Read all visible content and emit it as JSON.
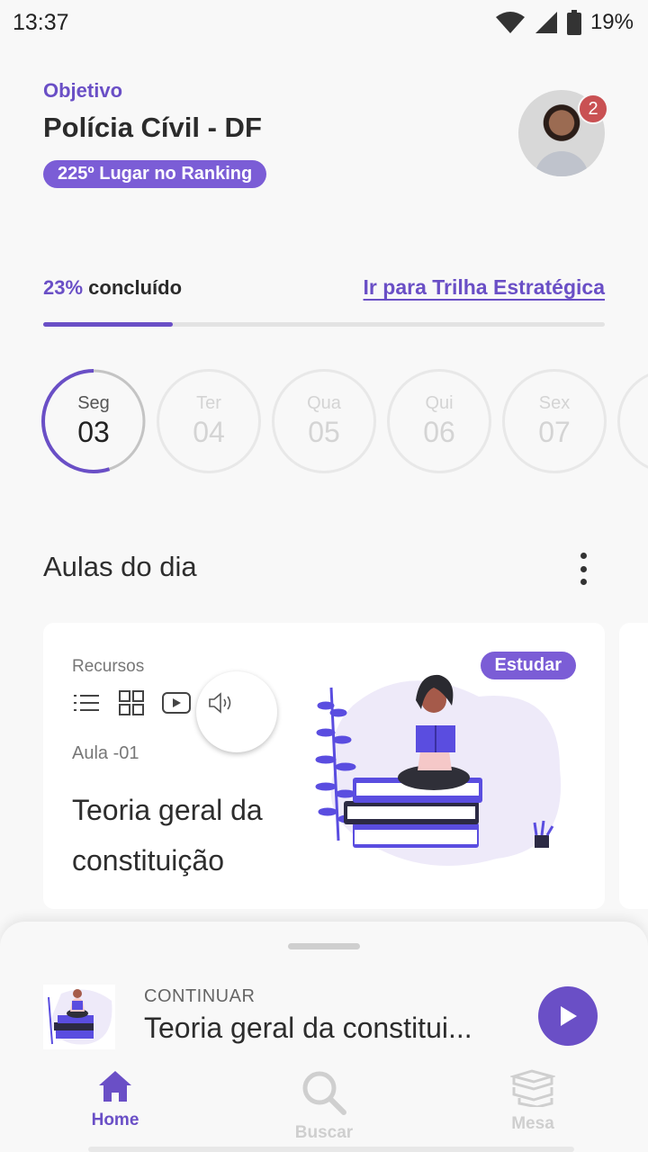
{
  "status_bar": {
    "time": "13:37",
    "battery": "19%"
  },
  "header": {
    "objective_label": "Objetivo",
    "objective_title": "Polícia Cívil - DF",
    "ranking_badge": "225º Lugar no Ranking",
    "notification_count": "2"
  },
  "progress": {
    "percent_text": "23%",
    "completed_text": " concluído",
    "value": 0.23,
    "link": "Ir para Trilha Estratégica"
  },
  "days": [
    {
      "name": "Seg",
      "number": "03",
      "active": true,
      "progress": 0.55
    },
    {
      "name": "Ter",
      "number": "04",
      "active": false
    },
    {
      "name": "Qua",
      "number": "05",
      "active": false
    },
    {
      "name": "Qui",
      "number": "06",
      "active": false
    },
    {
      "name": "Sex",
      "number": "07",
      "active": false
    }
  ],
  "section": {
    "title": "Aulas do dia"
  },
  "lesson_card": {
    "resources_label": "Recursos",
    "resource_icons": [
      "list-icon",
      "grid-icon",
      "video-icon",
      "audio-icon"
    ],
    "lesson_number": "Aula -01",
    "title": "Teoria geral da constituição",
    "badge": "Estudar"
  },
  "continue": {
    "label": "CONTINUAR",
    "title": "Teoria geral da constitui..."
  },
  "nav": {
    "home": "Home",
    "search": "Buscar",
    "desk": "Mesa"
  },
  "colors": {
    "accent": "#6a4fc6",
    "badge": "#7b5dd6",
    "notification": "#c95153"
  }
}
